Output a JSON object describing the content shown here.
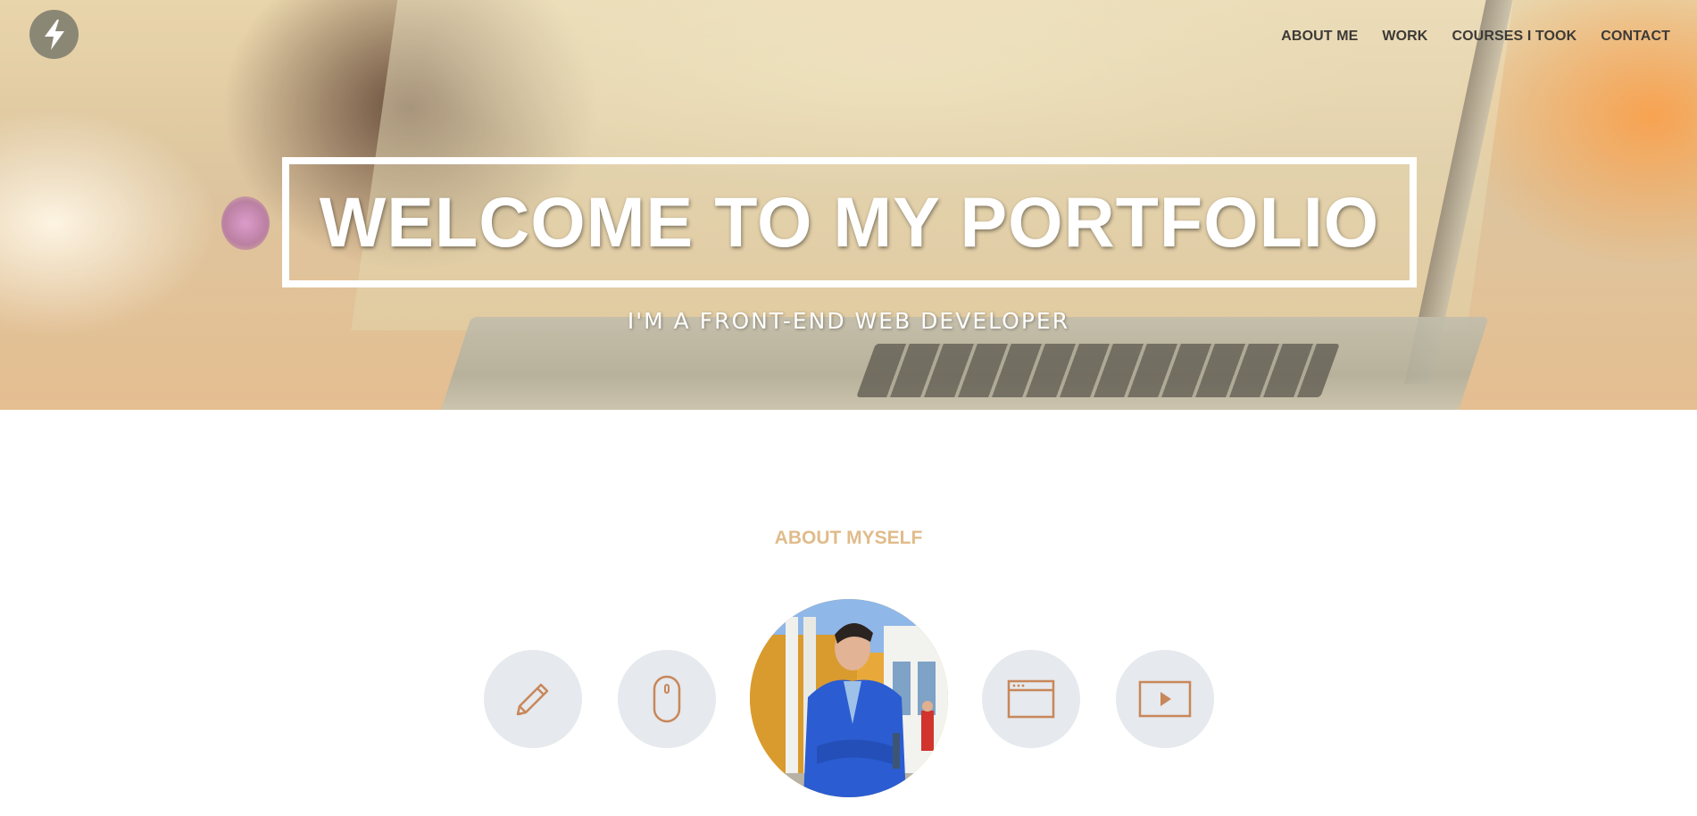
{
  "header": {
    "logo_icon": "lightning-bolt-icon",
    "nav": [
      {
        "label": "ABOUT ME"
      },
      {
        "label": "WORK"
      },
      {
        "label": "COURSES I TOOK"
      },
      {
        "label": "CONTACT"
      }
    ]
  },
  "hero": {
    "title": "WELCOME TO MY PORTFOLIO",
    "subtitle": "I'M A FRONT-END WEB DEVELOPER"
  },
  "about": {
    "title": "ABOUT MYSELF",
    "icons": [
      "pencil-icon",
      "mouse-icon",
      "browser-window-icon",
      "play-video-icon"
    ],
    "photo": "profile-photo"
  },
  "colors": {
    "accent": "#e0bc8b",
    "icon_stroke": "#c8875a",
    "circle_bg": "#e6e9ed",
    "nav_text": "#3c3a36",
    "logo_bg": "#8a8775"
  }
}
